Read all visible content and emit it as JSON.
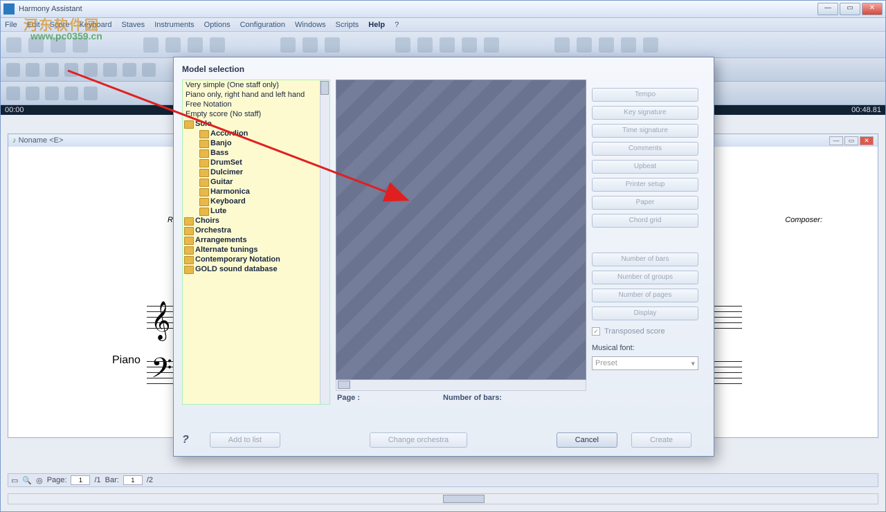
{
  "app": {
    "title": "Harmony Assistant"
  },
  "watermark": {
    "line1": "河东软件园",
    "line2": "www.pc0359.cn"
  },
  "menu": [
    "File",
    "Edit",
    "Score",
    "Keyboard",
    "Staves",
    "Instruments",
    "Options",
    "Configuration",
    "Windows",
    "Scripts",
    "Help",
    "?"
  ],
  "menu_active_index": 10,
  "timebar": {
    "left": "00:00",
    "right": "00:48.81"
  },
  "score_window": {
    "tab": "Noname <E>",
    "remarks_label": "Remarks:",
    "composer_label": "Composer:",
    "instrument": "Piano"
  },
  "bottom": {
    "page_label": "Page:",
    "page_val": "1",
    "page_total": "/1",
    "bar_label": "Bar:",
    "bar_val": "1",
    "bar_total": "/2"
  },
  "dialog": {
    "title": "Model selection",
    "list_flat": [
      "Very simple (One staff only)",
      "Piano only, right hand and left hand",
      "Free Notation",
      "Empty score (No staff)"
    ],
    "solo_label": "Solo",
    "solo_children": [
      "Accordion",
      "Banjo",
      "Bass",
      "DrumSet",
      "Dulcimer",
      "Guitar",
      "Harmonica",
      "Keyboard",
      "Lute"
    ],
    "folders_below": [
      "Choirs",
      "Orchestra",
      "Arrangements",
      "Alternate tunings",
      "Contemporary Notation",
      "GOLD sound database"
    ],
    "side_top": [
      "Tempo",
      "Key signature",
      "Time signature",
      "Comments",
      "Upbeat",
      "Printer setup",
      "Paper",
      "Chord grid"
    ],
    "side_mid": [
      "Number of bars",
      "Number of groups",
      "Number of pages",
      "Display"
    ],
    "transposed": "Transposed score",
    "font_label": "Musical font:",
    "font_value": "Preset",
    "page_label": "Page :",
    "nbars_label": "Number of bars:",
    "footer": {
      "add": "Add to list",
      "change": "Change orchestra",
      "cancel": "Cancel",
      "create": "Create"
    }
  }
}
